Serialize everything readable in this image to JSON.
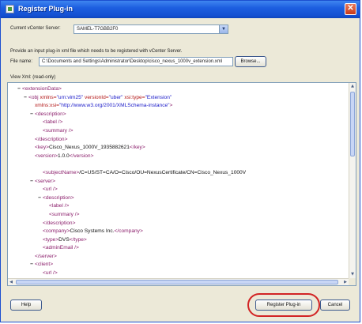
{
  "window": {
    "title": "Register Plug-in",
    "close_glyph": "✕"
  },
  "form": {
    "server_label": "Current vCenter Server:",
    "server_value": "SAMEL-T7GBB2F0",
    "instructions": "Provide an input plug-in xml file which needs to be registered with vCenter Server.",
    "file_label": "File name:",
    "file_value": "C:\\Documents and Settings\\Administrator\\Desktop\\cisco_nexus_1000v_extension.xml",
    "browse_label": "Browse...",
    "view_label": "View Xml: (read-only)"
  },
  "xml": {
    "lines": [
      {
        "i": 0,
        "e": "−",
        "parts": [
          {
            "c": "tg",
            "t": "<extensionData>"
          }
        ]
      },
      {
        "i": 1,
        "e": "−",
        "parts": [
          {
            "c": "tg",
            "t": "<obj "
          },
          {
            "c": "an",
            "t": "xmlns="
          },
          {
            "c": "av",
            "t": "\"urn:vim25\" "
          },
          {
            "c": "an",
            "t": "versionId="
          },
          {
            "c": "av",
            "t": "\"uber\" "
          },
          {
            "c": "an",
            "t": "xsi:type="
          },
          {
            "c": "av",
            "t": "\"Extension\""
          }
        ]
      },
      {
        "i": 2,
        "e": "",
        "parts": [
          {
            "c": "an",
            "t": "xmlns:xsi="
          },
          {
            "c": "av",
            "t": "\"http://www.w3.org/2001/XMLSchema-instance\""
          },
          {
            "c": "tg",
            "t": ">"
          }
        ]
      },
      {
        "i": 2,
        "e": "−",
        "parts": [
          {
            "c": "tg",
            "t": "<description>"
          }
        ]
      },
      {
        "i": 3,
        "e": "",
        "parts": [
          {
            "c": "tg",
            "t": "<label />"
          }
        ]
      },
      {
        "i": 3,
        "e": "",
        "parts": [
          {
            "c": "tg",
            "t": "<summary />"
          }
        ]
      },
      {
        "i": 2,
        "e": "",
        "parts": [
          {
            "c": "tg",
            "t": "</description>"
          }
        ]
      },
      {
        "i": 2,
        "e": "",
        "parts": [
          {
            "c": "tg",
            "t": "<key>"
          },
          {
            "c": "tx",
            "t": "Cisco_Nexus_1000V_1935882621"
          },
          {
            "c": "tg",
            "t": "</key>"
          }
        ]
      },
      {
        "i": 2,
        "e": "",
        "parts": [
          {
            "c": "tg",
            "t": "<version>"
          },
          {
            "c": "tx",
            "t": "1.0.0"
          },
          {
            "c": "tg",
            "t": "</version>"
          }
        ]
      },
      {
        "i": 2,
        "e": "",
        "parts": [
          {
            "c": "tx",
            "t": " "
          }
        ]
      },
      {
        "i": 3,
        "e": "",
        "parts": [
          {
            "c": "tg",
            "t": "<subjectName>"
          },
          {
            "c": "tx",
            "t": "/C=US/ST=CA/O=Cisco/OU=NexusCertificate/CN=Cisco_Nexus_1000V"
          }
        ]
      },
      {
        "i": 2,
        "e": "−",
        "parts": [
          {
            "c": "tg",
            "t": "<server>"
          }
        ]
      },
      {
        "i": 3,
        "e": "",
        "parts": [
          {
            "c": "tg",
            "t": "<url />"
          }
        ]
      },
      {
        "i": 3,
        "e": "−",
        "parts": [
          {
            "c": "tg",
            "t": "<description>"
          }
        ]
      },
      {
        "i": 4,
        "e": "",
        "parts": [
          {
            "c": "tg",
            "t": "<label />"
          }
        ]
      },
      {
        "i": 4,
        "e": "",
        "parts": [
          {
            "c": "tg",
            "t": "<summary />"
          }
        ]
      },
      {
        "i": 3,
        "e": "",
        "parts": [
          {
            "c": "tg",
            "t": "</description>"
          }
        ]
      },
      {
        "i": 3,
        "e": "",
        "parts": [
          {
            "c": "tg",
            "t": "<company>"
          },
          {
            "c": "tx",
            "t": "Cisco Systems Inc."
          },
          {
            "c": "tg",
            "t": "</company>"
          }
        ]
      },
      {
        "i": 3,
        "e": "",
        "parts": [
          {
            "c": "tg",
            "t": "<type>"
          },
          {
            "c": "tx",
            "t": "DVS"
          },
          {
            "c": "tg",
            "t": "</type>"
          }
        ]
      },
      {
        "i": 3,
        "e": "",
        "parts": [
          {
            "c": "tg",
            "t": "<adminEmail />"
          }
        ]
      },
      {
        "i": 2,
        "e": "",
        "parts": [
          {
            "c": "tg",
            "t": "</server>"
          }
        ]
      },
      {
        "i": 2,
        "e": "−",
        "parts": [
          {
            "c": "tg",
            "t": "<client>"
          }
        ]
      },
      {
        "i": 3,
        "e": "",
        "parts": [
          {
            "c": "tg",
            "t": "<url />"
          }
        ]
      },
      {
        "i": 3,
        "e": "−",
        "parts": [
          {
            "c": "tg",
            "t": "<description>"
          }
        ]
      }
    ]
  },
  "buttons": {
    "help": "Help",
    "register": "Register Plug-in",
    "cancel": "Cancel"
  },
  "colors": {
    "title_bar": "#1d5fe0",
    "dialog_bg": "#ece9d8",
    "annotation_ring": "#d22424"
  }
}
